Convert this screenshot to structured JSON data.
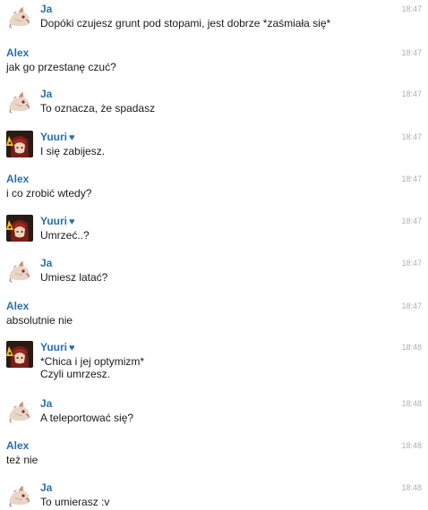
{
  "messages": [
    {
      "author": "Ja",
      "type": "ja",
      "text": [
        "Dopóki czujesz grunt pod stopami, jest dobrze *zaśmiała się*"
      ],
      "time": "18:47"
    },
    {
      "author": "Alex",
      "type": "alex",
      "text": [
        "jak go przestanę czuć?"
      ],
      "time": "18:47"
    },
    {
      "author": "Ja",
      "type": "ja",
      "text": [
        "To oznacza, że spadasz"
      ],
      "time": "18:47"
    },
    {
      "author": "Yuuri",
      "type": "yuuri",
      "heart": "♥",
      "text": [
        "I się zabijesz."
      ],
      "time": "18:47"
    },
    {
      "author": "Alex",
      "type": "alex",
      "text": [
        "i co zrobić wtedy?"
      ],
      "time": "18:47"
    },
    {
      "author": "Yuuri",
      "type": "yuuri",
      "heart": "♥",
      "text": [
        "Umrzeć..?"
      ],
      "time": "18:47"
    },
    {
      "author": "Ja",
      "type": "ja",
      "text": [
        "Umiesz latać?"
      ],
      "time": "18:47"
    },
    {
      "author": "Alex",
      "type": "alex",
      "text": [
        "absolutnie nie"
      ],
      "time": "18:47"
    },
    {
      "author": "Yuuri",
      "type": "yuuri",
      "heart": "♥",
      "text": [
        "*Chica i jej optymizm*",
        "Czyli umrzesz."
      ],
      "time": "18:48"
    },
    {
      "author": "Ja",
      "type": "ja",
      "text": [
        "A teleportować się?"
      ],
      "time": "18:48"
    },
    {
      "author": "Alex",
      "type": "alex",
      "text": [
        "też nie"
      ],
      "time": "18:48"
    },
    {
      "author": "Ja",
      "type": "ja",
      "text": [
        "To umierasz :v"
      ],
      "time": "18:48"
    }
  ]
}
